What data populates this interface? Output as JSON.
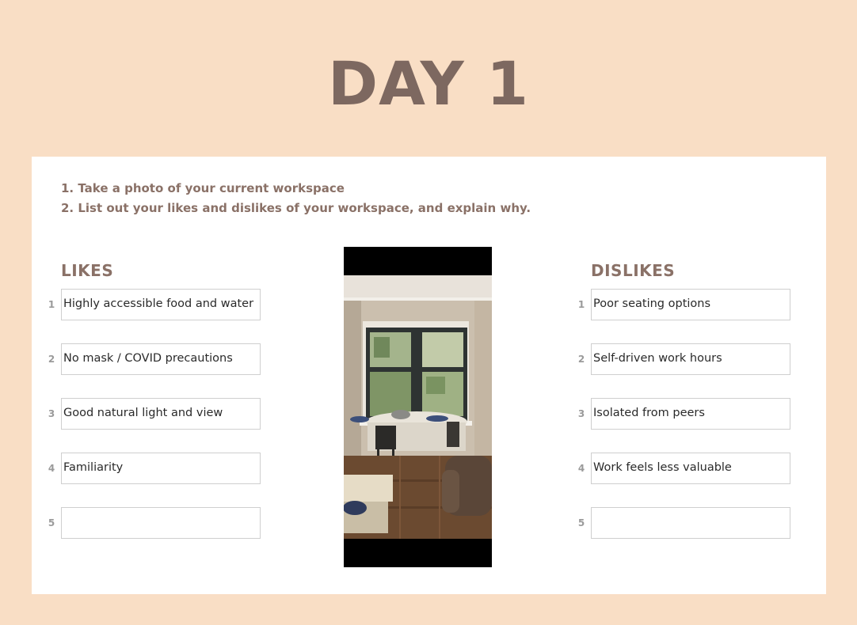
{
  "title": "DAY 1",
  "instructions": [
    "1. Take a photo of your current workspace",
    "2. List out your likes and dislikes of your workspace, and explain why."
  ],
  "likes": {
    "heading": "LIKES",
    "items": [
      {
        "num": "1",
        "text": "Highly accessible food and water"
      },
      {
        "num": "2",
        "text": "No mask / COVID precautions"
      },
      {
        "num": "3",
        "text": "Good natural light and view"
      },
      {
        "num": "4",
        "text": "Familiarity"
      },
      {
        "num": "5",
        "text": ""
      }
    ]
  },
  "dislikes": {
    "heading": "DISLIKES",
    "items": [
      {
        "num": "1",
        "text": "Poor seating options"
      },
      {
        "num": "2",
        "text": "Self-driven work hours"
      },
      {
        "num": "3",
        "text": "Isolated from peers"
      },
      {
        "num": "4",
        "text": "Work feels less valuable"
      },
      {
        "num": "5",
        "text": ""
      }
    ]
  },
  "colors": {
    "background": "#f9dec5",
    "card": "#ffffff",
    "heading": "#7d6860",
    "accent_text": "#8a7167",
    "box_border": "#cfcfcf"
  }
}
